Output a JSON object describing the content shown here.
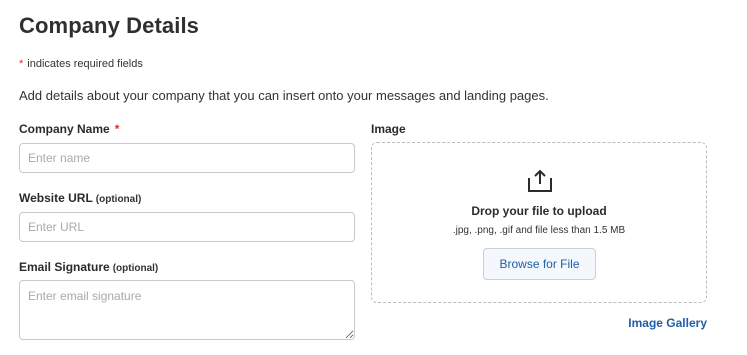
{
  "page": {
    "title": "Company Details",
    "required_star": "*",
    "required_note": "indicates required fields",
    "intro": "Add details about your company that you can insert onto your messages and landing pages."
  },
  "form": {
    "company_name": {
      "label": "Company Name",
      "required_star": "*",
      "value": "",
      "placeholder": "Enter name"
    },
    "website_url": {
      "label": "Website URL",
      "optional": "(optional)",
      "value": "",
      "placeholder": "Enter URL"
    },
    "email_signature": {
      "label": "Email Signature",
      "optional": "(optional)",
      "value": "",
      "placeholder": "Enter email signature"
    }
  },
  "image": {
    "label": "Image",
    "icon": "upload-icon",
    "drop_title": "Drop your file to upload",
    "drop_subtitle": ".jpg, .png, .gif and file less than 1.5 MB",
    "browse_label": "Browse for File",
    "gallery_link": "Image Gallery"
  },
  "colors": {
    "required": "#d93025",
    "link": "#1f5fa8",
    "button_bg": "#f4f7fb",
    "border": "#c9c9c9"
  }
}
